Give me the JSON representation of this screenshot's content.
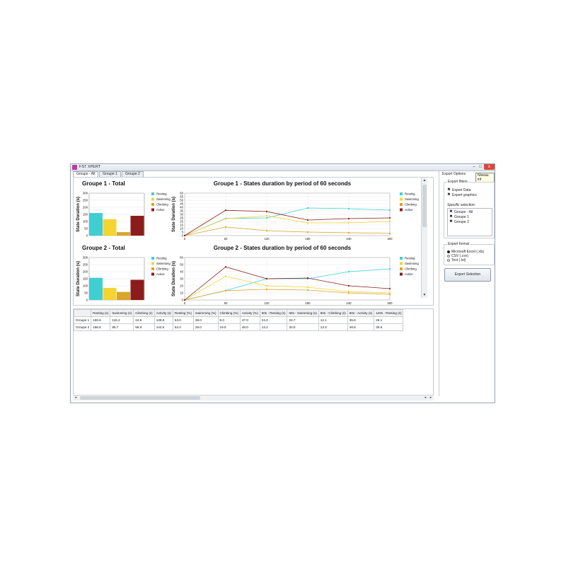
{
  "window": {
    "title": "FST XPERT",
    "controls": {
      "minimize": "–",
      "maximize": "□",
      "close": "x"
    }
  },
  "tabs": [
    "Groups - All",
    "Groupe 1",
    "Groupe 2"
  ],
  "legend": [
    "Resting",
    "Swimming",
    "Climbing",
    "Active"
  ],
  "colors": {
    "resting": "#3fcfd0",
    "swimming": "#f3d431",
    "climbing": "#d9a52a",
    "active": "#8c1c1c"
  },
  "chart_data": [
    {
      "type": "bar",
      "title": "Groupe 1 - Total",
      "ylabel": "State Duration (s)",
      "ylim": [
        0,
        300
      ],
      "yticks": [
        "0",
        "50",
        "100",
        "150",
        "200",
        "250",
        "300"
      ],
      "series": [
        {
          "name": "Resting",
          "values": [
            159.6
          ]
        },
        {
          "name": "Swimming",
          "values": [
            115.2
          ]
        },
        {
          "name": "Climbing",
          "values": [
            24.6
          ]
        },
        {
          "name": "Active",
          "values": [
            139.8
          ]
        }
      ]
    },
    {
      "type": "line",
      "title": "Groupe 1 - States duration by period of 60 seconds",
      "ylabel": "State Duration (s)",
      "x": [
        0,
        60,
        120,
        180,
        240,
        300
      ],
      "xticks": [
        "0",
        "60",
        "120",
        "180",
        "240",
        "300"
      ],
      "ylim": [
        0,
        60
      ],
      "yticks": [
        "0",
        "5",
        "10",
        "15",
        "20",
        "25",
        "30",
        "35",
        "40",
        "45",
        "50",
        "55",
        "60"
      ],
      "series": [
        {
          "name": "Resting",
          "values": [
            0,
            24.2,
            25,
            39,
            38,
            36
          ]
        },
        {
          "name": "Swimming",
          "values": [
            0,
            23.7,
            28,
            18,
            18,
            20
          ]
        },
        {
          "name": "Climbing",
          "values": [
            0,
            12.1,
            7,
            5,
            4,
            3
          ]
        },
        {
          "name": "Active",
          "values": [
            0,
            35.8,
            34,
            22,
            24,
            25
          ]
        }
      ]
    },
    {
      "type": "bar",
      "title": "Groupe 2 - Total",
      "ylabel": "State Duration (s)",
      "ylim": [
        0,
        300
      ],
      "yticks": [
        "0",
        "50",
        "100",
        "150",
        "200",
        "250",
        "300"
      ],
      "series": [
        {
          "name": "Resting",
          "values": [
            156.8
          ]
        },
        {
          "name": "Swimming",
          "values": [
            85.7
          ]
        },
        {
          "name": "Climbing",
          "values": [
            56.9
          ]
        },
        {
          "name": "Active",
          "values": [
            142.6
          ]
        }
      ]
    },
    {
      "type": "line",
      "title": "Groupe 2 - States duration by period of 60 seconds",
      "ylabel": "State Duration (s)",
      "x": [
        0,
        60,
        120,
        180,
        240,
        300
      ],
      "xticks": [
        "0",
        "60",
        "120",
        "180",
        "240",
        "300"
      ],
      "ylim": [
        0,
        60
      ],
      "yticks": [
        "0",
        "10",
        "20",
        "30",
        "40",
        "50",
        "60"
      ],
      "series": [
        {
          "name": "Resting",
          "values": [
            0,
            13.2,
            30,
            30,
            40,
            44
          ]
        },
        {
          "name": "Swimming",
          "values": [
            0,
            33.5,
            20,
            18,
            12,
            10
          ]
        },
        {
          "name": "Climbing",
          "values": [
            0,
            13.3,
            15,
            14,
            10,
            8
          ]
        },
        {
          "name": "Active",
          "values": [
            0,
            46.8,
            30,
            31,
            20,
            16
          ]
        }
      ]
    }
  ],
  "table": {
    "columns": [
      "",
      "Resting (s)",
      "Swimming (s)",
      "Climbing (s)",
      "Activity (s)",
      "Resting (%)",
      "Swimming (%)",
      "Climbing (%)",
      "Activity (%)",
      "60s - Resting (s)",
      "60s - Swimming (s)",
      "60s - Climbing (s)",
      "60s - Activity (s)",
      "120s - Resting (s)"
    ],
    "rows": [
      [
        "Groupe 1",
        "159.6",
        "115.2",
        "24.6",
        "139.8",
        "53.0",
        "38.0",
        "8.0",
        "47.0",
        "24.2",
        "23.7",
        "12.1",
        "35.8",
        "26.1"
      ],
      [
        "Groupe 2",
        "156.8",
        "85.7",
        "56.9",
        "142.6",
        "52.0",
        "29.0",
        "19.0",
        "48.0",
        "13.2",
        "33.5",
        "13.3",
        "46.8",
        "30.6"
      ]
    ]
  },
  "side": {
    "title": "Export Options",
    "tooltip": "Niveau inf",
    "filters_label": "Export filters",
    "filters": [
      {
        "label": "Export Data",
        "checked": true
      },
      {
        "label": "Export graphics",
        "checked": true
      }
    ],
    "specific_label": "Specific selection:",
    "selection": [
      {
        "label": "Groups - All",
        "checked": true
      },
      {
        "label": "Groupe 1",
        "checked": true
      },
      {
        "label": "Groupe 2",
        "checked": true
      }
    ],
    "format_label": "Export format",
    "formats": [
      {
        "label": "Microsoft Excel (.xls)",
        "selected": true
      },
      {
        "label": "CSV (.csv)",
        "selected": false
      },
      {
        "label": "Text (.txt)",
        "selected": false
      }
    ],
    "export_button": "Export Selection"
  }
}
